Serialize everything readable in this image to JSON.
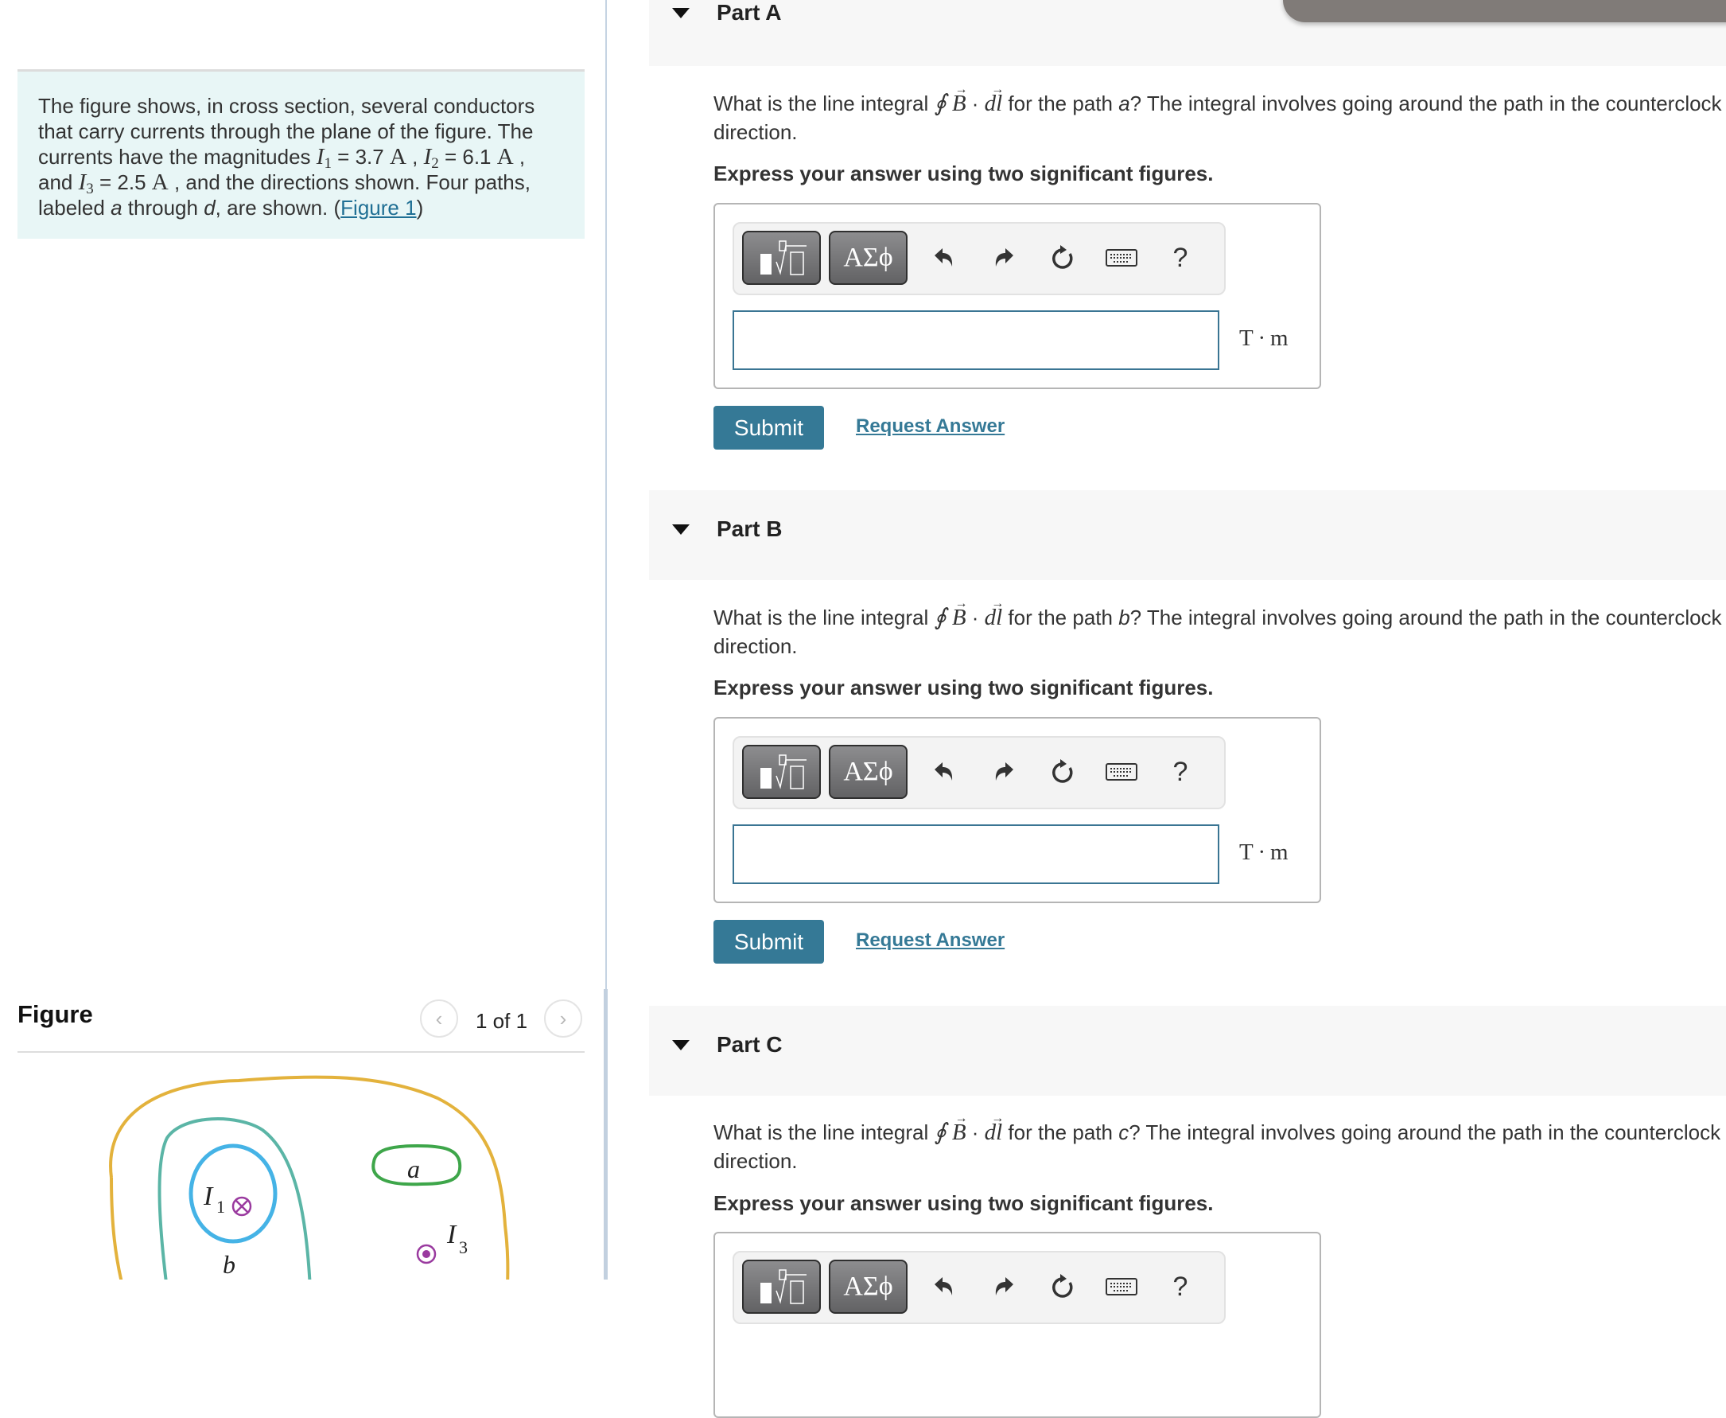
{
  "intro": {
    "line1": "The figure shows, in cross section, several conductors",
    "line2": "that carry currents through the plane of the figure. The",
    "line3_pre": "currents have the magnitudes ",
    "I1_sym": "I",
    "I1_sub": "1",
    "I1_val": " = 3.7 ",
    "I2_sym": "I",
    "I2_sub": "2",
    "I2_val": " = 6.1 ",
    "unit_A": "A",
    "comma": " , ",
    "comma_end": " ,",
    "line4_pre": "and ",
    "I3_sym": "I",
    "I3_sub": "3",
    "I3_val": " = 2.5 ",
    "line4_post": " , and the directions shown. Four paths,",
    "line5_pre": "labeled ",
    "a": "a",
    "line5_mid": " through ",
    "d": "d",
    "line5_post": ", are shown. (",
    "figure_link": "Figure 1",
    "close_paren": ")"
  },
  "figure": {
    "title": "Figure",
    "counter": "1 of 1",
    "prev_icon": "chevron-left",
    "next_icon": "chevron-right",
    "labels": {
      "I1": "I",
      "I1_sub": "1",
      "I3": "I",
      "I3_sub": "3",
      "path_a": "a",
      "path_b": "b"
    },
    "colors": {
      "outer_path": "#e3b23c",
      "path_b": "#5bb5a6",
      "path_inner": "#45b3e6",
      "path_a": "#3ea64a",
      "current": "#9a3a9f"
    }
  },
  "tooltip": {
    "text": ""
  },
  "parts": [
    {
      "label": "Part A",
      "q_pre": "What is the line integral ",
      "oint": "∮",
      "B": "B",
      "dot": " · ",
      "dl": "dl",
      "q_mid": " for the path ",
      "path": "a",
      "q_post": "? The integral involves going around the path in the counterclock",
      "q_line2": "direction.",
      "instruction": "Express your answer using two significant figures.",
      "input_value": "",
      "unit": "T · m",
      "submit": "Submit",
      "request": "Request Answer"
    },
    {
      "label": "Part B",
      "q_pre": "What is the line integral ",
      "oint": "∮",
      "B": "B",
      "dot": " · ",
      "dl": "dl",
      "q_mid": " for the path ",
      "path": "b",
      "q_post": "? The integral involves going around the path in the counterclock",
      "q_line2": "direction.",
      "instruction": "Express your answer using two significant figures.",
      "input_value": "",
      "unit": "T · m",
      "submit": "Submit",
      "request": "Request Answer"
    },
    {
      "label": "Part C",
      "q_pre": "What is the line integral ",
      "oint": "∮",
      "B": "B",
      "dot": " · ",
      "dl": "dl",
      "q_mid": " for the path ",
      "path": "c",
      "q_post": "? The integral involves going around the path in the counterclock",
      "q_line2": "direction.",
      "instruction": "Express your answer using two significant figures."
    }
  ],
  "toolbar": {
    "templates_icon": "fraction-root-template",
    "greek_label": "ΑΣϕ",
    "undo_icon": "undo",
    "redo_icon": "redo",
    "reset_icon": "reset",
    "keyboard_icon": "keyboard",
    "help_label": "?"
  },
  "colors": {
    "accent": "#357996",
    "intro_bg": "#e8f6f6",
    "part_band": "#f7f7f7"
  }
}
